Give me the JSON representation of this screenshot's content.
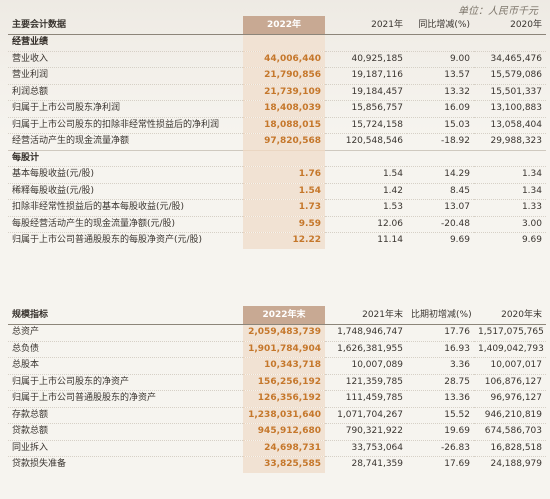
{
  "unit": "单位：人民币千元",
  "table1": {
    "header": [
      "主要会计数据",
      "2022年",
      "2021年",
      "同比增减(%)",
      "2020年"
    ],
    "sections": [
      {
        "title": "经营业绩",
        "rows": [
          [
            "营业收入",
            "44,006,440",
            "40,925,185",
            "9.00",
            "34,465,476"
          ],
          [
            "营业利润",
            "21,790,856",
            "19,187,116",
            "13.57",
            "15,579,086"
          ],
          [
            "利润总额",
            "21,739,109",
            "19,184,457",
            "13.32",
            "15,501,337"
          ],
          [
            "归属于上市公司股东净利润",
            "18,408,039",
            "15,856,757",
            "16.09",
            "13,100,883"
          ],
          [
            "归属于上市公司股东的扣除非经常性损益后的净利润",
            "18,088,015",
            "15,724,158",
            "15.03",
            "13,058,404"
          ],
          [
            "经营活动产生的现金流量净额",
            "97,820,568",
            "120,548,546",
            "-18.92",
            "29,988,323"
          ]
        ]
      },
      {
        "title": "每股计",
        "rows": [
          [
            "基本每股收益(元/股)",
            "1.76",
            "1.54",
            "14.29",
            "1.34"
          ],
          [
            "稀释每股收益(元/股)",
            "1.54",
            "1.42",
            "8.45",
            "1.34"
          ],
          [
            "扣除非经常性损益后的基本每股收益(元/股)",
            "1.73",
            "1.53",
            "13.07",
            "1.33"
          ],
          [
            "每股经营活动产生的现金流量净额(元/股)",
            "9.59",
            "12.06",
            "-20.48",
            "3.00"
          ],
          [
            "归属于上市公司普通股股东的每股净资产(元/股)",
            "12.22",
            "11.14",
            "9.69",
            "9.69"
          ]
        ]
      }
    ]
  },
  "table2": {
    "header": [
      "规模指标",
      "2022年末",
      "2021年末",
      "比期初增减(%)",
      "2020年末"
    ],
    "rows": [
      [
        "总资产",
        "2,059,483,739",
        "1,748,946,747",
        "17.76",
        "1,517,075,765"
      ],
      [
        "总负债",
        "1,901,784,904",
        "1,626,381,955",
        "16.93",
        "1,409,042,793"
      ],
      [
        "总股本",
        "10,343,718",
        "10,007,089",
        "3.36",
        "10,007,017"
      ],
      [
        "归属于上市公司股东的净资产",
        "156,256,192",
        "121,359,785",
        "28.75",
        "106,876,127"
      ],
      [
        "归属于上市公司普通股股东的净资产",
        "126,356,192",
        "111,459,785",
        "13.36",
        "96,976,127"
      ],
      [
        "存款总额",
        "1,238,031,640",
        "1,071,704,267",
        "15.52",
        "946,210,819"
      ],
      [
        "贷款总额",
        "945,912,680",
        "790,321,922",
        "19.69",
        "674,586,703"
      ],
      [
        "同业拆入",
        "24,698,731",
        "33,753,064",
        "-26.83",
        "16,828,518"
      ],
      [
        "贷款损失准备",
        "33,825,585",
        "28,741,359",
        "17.69",
        "24,188,979"
      ]
    ]
  }
}
